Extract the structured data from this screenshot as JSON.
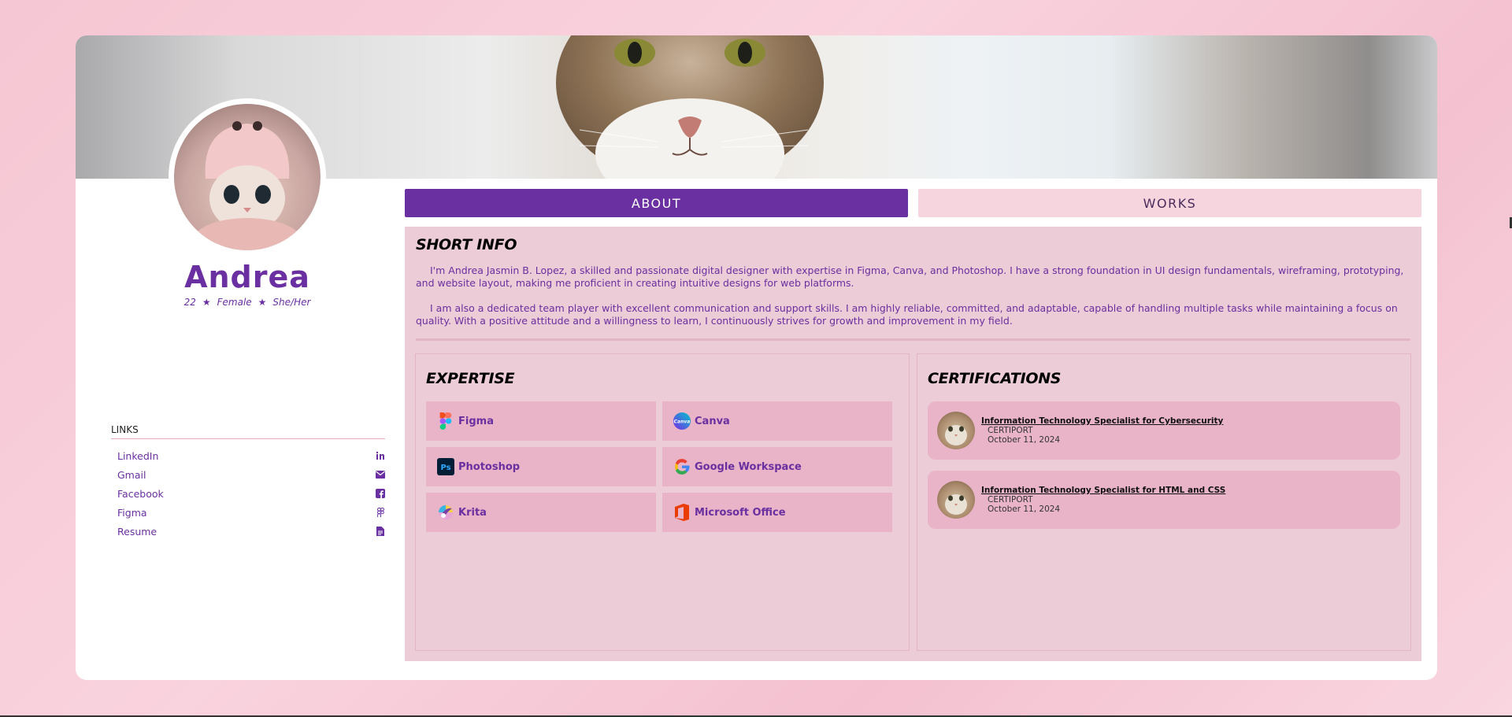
{
  "profile": {
    "name": "Andrea",
    "age": "22",
    "gender": "Female",
    "pronouns": "She/Her",
    "separator": "★"
  },
  "links": {
    "title": "LINKS",
    "items": [
      {
        "label": "LinkedIn",
        "icon": "linkedin-icon"
      },
      {
        "label": "Gmail",
        "icon": "envelope-icon"
      },
      {
        "label": "Facebook",
        "icon": "facebook-icon"
      },
      {
        "label": "Figma",
        "icon": "figma-icon"
      },
      {
        "label": "Resume",
        "icon": "document-icon"
      }
    ]
  },
  "tabs": {
    "about": "ABOUT",
    "works": "WORKS"
  },
  "short_info": {
    "title": "SHORT INFO",
    "para1": "I'm Andrea Jasmin B. Lopez, a skilled and passionate digital designer with expertise in Figma, Canva, and Photoshop. I have a strong foundation in UI design fundamentals, wireframing, prototyping, and website layout, making me proficient in creating intuitive designs for web platforms.",
    "para2": "I am also a dedicated team player with excellent communication and support skills. I am highly reliable, committed, and adaptable, capable of handling multiple tasks while maintaining a focus on quality. With a positive attitude and a willingness to learn, I continuously strives for growth and improvement in my field."
  },
  "expertise": {
    "title": "EXPERTISE",
    "items": [
      {
        "label": "Figma",
        "icon": "figma-logo-icon"
      },
      {
        "label": "Canva",
        "icon": "canva-logo-icon"
      },
      {
        "label": "Photoshop",
        "icon": "photoshop-logo-icon"
      },
      {
        "label": "Google Workspace",
        "icon": "google-logo-icon"
      },
      {
        "label": "Krita",
        "icon": "krita-logo-icon"
      },
      {
        "label": "Microsoft Office",
        "icon": "office-logo-icon"
      }
    ]
  },
  "certifications": {
    "title": "CERTIFICATIONS",
    "items": [
      {
        "title": "Information Technology Specialist for Cybersecurity",
        "issuer": "CERTIPORT",
        "date": "October 11, 2024"
      },
      {
        "title": "Information Technology Specialist for HTML and CSS",
        "issuer": "CERTIPORT",
        "date": "October 11, 2024"
      }
    ]
  },
  "colors": {
    "accent": "#6a2fa0",
    "panel": "#ecccd6",
    "tile": "#e9b4c7",
    "background": "#f7cbd7"
  }
}
